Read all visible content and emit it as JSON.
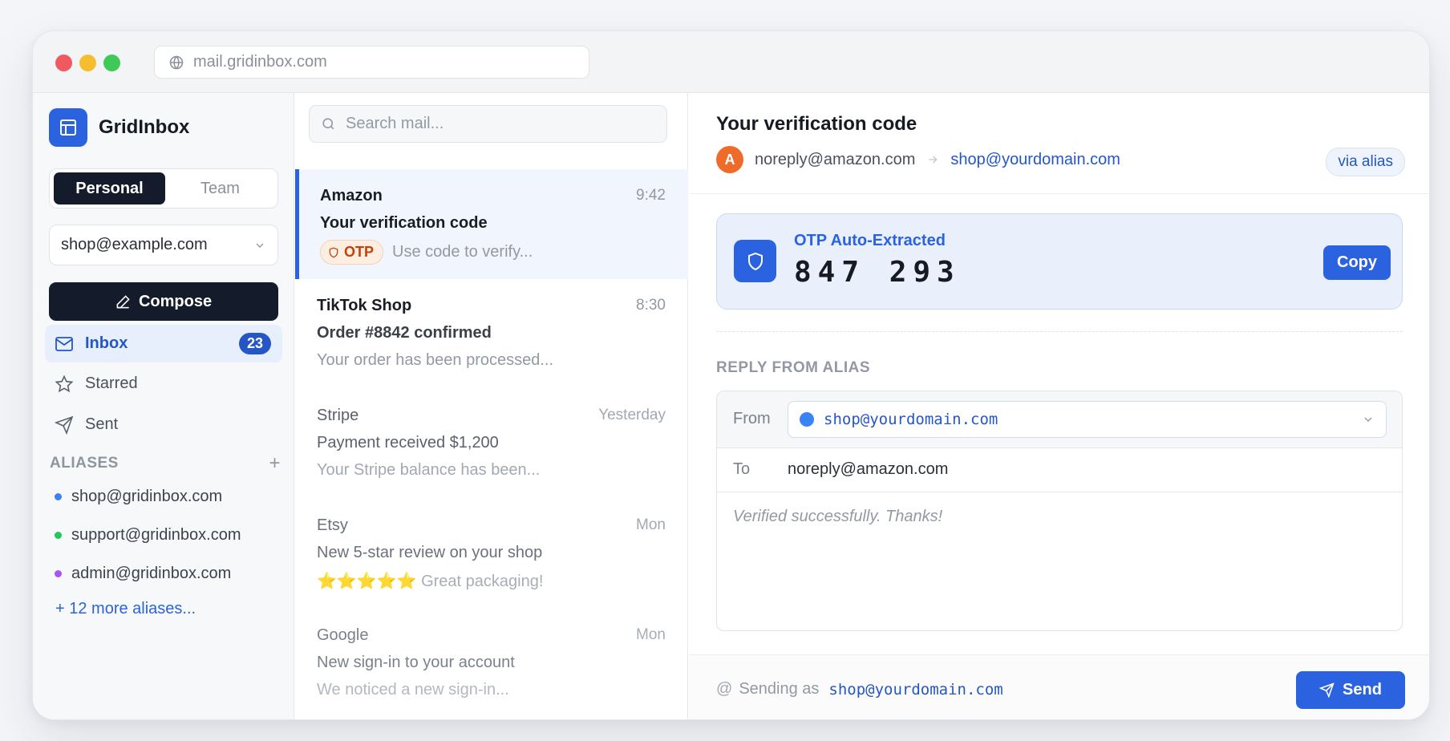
{
  "browser": {
    "url": "mail.gridinbox.com",
    "icons": [
      "globe-icon"
    ]
  },
  "sidebar": {
    "brand": "GridInbox",
    "workspace_tabs": [
      {
        "label": "Personal",
        "active": true
      },
      {
        "label": "Team",
        "active": false
      }
    ],
    "account": "shop@example.com",
    "compose_label": "Compose",
    "nav": [
      {
        "label": "Inbox",
        "icon": "mail-icon",
        "badge": "23",
        "active": true
      },
      {
        "label": "Starred",
        "icon": "star-icon"
      },
      {
        "label": "Sent",
        "icon": "send-icon"
      }
    ],
    "aliases_heading": "ALIASES",
    "aliases": [
      {
        "address": "shop@gridinbox.com",
        "color": "#3b82f6"
      },
      {
        "address": "support@gridinbox.com",
        "color": "#22c55e"
      },
      {
        "address": "admin@gridinbox.com",
        "color": "#a855f7"
      }
    ],
    "more_aliases": "+ 12 more aliases..."
  },
  "mail_list": {
    "search_placeholder": "Search mail...",
    "items": [
      {
        "sender": "Amazon",
        "time": "9:42",
        "subject": "Your verification code",
        "chip": "OTP",
        "preview": "Use code to verify...",
        "selected": true
      },
      {
        "sender": "TikTok Shop",
        "time": "8:30",
        "subject": "Order #8842 confirmed",
        "preview": "Your order has been processed..."
      },
      {
        "sender": "Stripe",
        "time": "Yesterday",
        "subject": "Payment received $1,200",
        "preview": "Your Stripe balance has been..."
      },
      {
        "sender": "Etsy",
        "time": "Mon",
        "subject": "New 5-star review on your shop",
        "preview": "⭐⭐⭐⭐⭐ Great packaging!"
      },
      {
        "sender": "Google",
        "time": "Mon",
        "subject": "New sign-in to your account",
        "preview": "We noticed a new sign-in..."
      }
    ]
  },
  "reader": {
    "subject": "Your verification code",
    "avatar_letter": "A",
    "from": "noreply@amazon.com",
    "to": "shop@yourdomain.com",
    "via": "via alias",
    "otp": {
      "label": "OTP Auto-Extracted",
      "code": "847 293",
      "copy_label": "Copy"
    },
    "reply": {
      "heading": "REPLY FROM ALIAS",
      "from_label": "From",
      "from_value": "shop@yourdomain.com",
      "to_label": "To",
      "to_value": "noreply@amazon.com",
      "body": "Verified successfully. Thanks!"
    },
    "footer": {
      "sending_as_label": "Sending as",
      "sending_as": "shop@yourdomain.com",
      "send_label": "Send"
    }
  },
  "colors": {
    "accent": "#2a62e0",
    "dark": "#141b2b",
    "otp_chip": "#c2410c",
    "avatar": "#ef6b2a"
  }
}
